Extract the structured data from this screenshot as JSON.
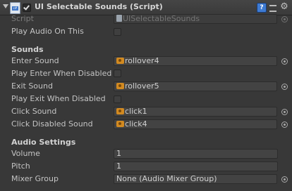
{
  "header": {
    "title": "UI Selectable Sounds (Script)",
    "help_label": "?",
    "gear_icon": "gear-icon",
    "preset_icon": "preset-icon"
  },
  "script_field": {
    "label": "Script",
    "value": "UISelectableSounds"
  },
  "play_audio_on_this": {
    "label": "Play Audio On This",
    "checked": false
  },
  "sounds": {
    "heading": "Sounds",
    "enter_sound": {
      "label": "Enter Sound",
      "value": "rollover4"
    },
    "play_enter_when_disabled": {
      "label": "Play Enter When Disabled",
      "checked": false
    },
    "exit_sound": {
      "label": "Exit Sound",
      "value": "rollover5"
    },
    "play_exit_when_disabled": {
      "label": "Play Exit When Disabled",
      "checked": false
    },
    "click_sound": {
      "label": "Click Sound",
      "value": "click1"
    },
    "click_disabled_sound": {
      "label": "Click Disabled Sound",
      "value": "click4"
    }
  },
  "audio_settings": {
    "heading": "Audio Settings",
    "volume": {
      "label": "Volume",
      "value": "1"
    },
    "pitch": {
      "label": "Pitch",
      "value": "1"
    },
    "mixer_group": {
      "label": "Mixer Group",
      "value": "None (Audio Mixer Group)"
    }
  },
  "colors": {
    "background": "#383838",
    "header": "#404040",
    "field": "#434343",
    "audio_icon": "#d28a21",
    "help_button": "#3e7bd3"
  }
}
